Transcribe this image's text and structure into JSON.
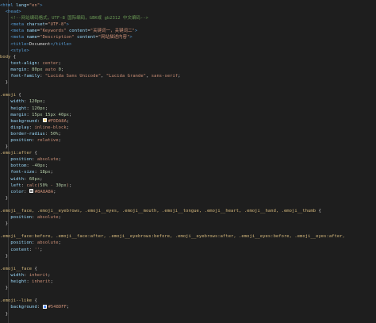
{
  "colors": {
    "background": "#1e1e1e",
    "tag": "#569cd6",
    "attribute": "#9cdcfe",
    "string": "#ce9178",
    "comment": "#6a9955",
    "selector": "#d7ba7d",
    "number": "#b5cea8",
    "swatch_emoji_bg": "#FDDA8A",
    "swatch_after": "#8A8A8A",
    "swatch_like": "#548DFF"
  },
  "lines": [
    {
      "tokens": [
        {
          "t": "tag",
          "v": "<html "
        },
        {
          "t": "attr",
          "v": "lang"
        },
        {
          "t": "punc",
          "v": "="
        },
        {
          "t": "str",
          "v": "\"en\""
        },
        {
          "t": "tag",
          "v": ">"
        }
      ]
    },
    {
      "tokens": [
        {
          "t": "text",
          "v": "  "
        },
        {
          "t": "tag",
          "v": "<head>"
        }
      ]
    },
    {
      "tokens": [
        {
          "t": "text",
          "v": "    "
        },
        {
          "t": "comment",
          "v": "<!--网站编码格式，UTF-8 国际编码，GBK或 gb2312 中文编码-->"
        }
      ]
    },
    {
      "tokens": [
        {
          "t": "text",
          "v": "    "
        },
        {
          "t": "tag",
          "v": "<meta "
        },
        {
          "t": "attr",
          "v": "charset"
        },
        {
          "t": "punc",
          "v": "="
        },
        {
          "t": "str",
          "v": "\"UTF-8\""
        },
        {
          "t": "tag",
          "v": ">"
        }
      ]
    },
    {
      "tokens": [
        {
          "t": "text",
          "v": "    "
        },
        {
          "t": "tag",
          "v": "<meta "
        },
        {
          "t": "attr",
          "v": "name"
        },
        {
          "t": "punc",
          "v": "="
        },
        {
          "t": "str",
          "v": "\"Keywords\""
        },
        {
          "t": "text",
          "v": " "
        },
        {
          "t": "attr",
          "v": "content"
        },
        {
          "t": "punc",
          "v": "="
        },
        {
          "t": "str",
          "v": "\"关键词一，关键词二\""
        },
        {
          "t": "tag",
          "v": ">"
        }
      ]
    },
    {
      "tokens": [
        {
          "t": "text",
          "v": "    "
        },
        {
          "t": "tag",
          "v": "<meta "
        },
        {
          "t": "attr",
          "v": "name"
        },
        {
          "t": "punc",
          "v": "="
        },
        {
          "t": "str",
          "v": "\"Description\""
        },
        {
          "t": "text",
          "v": " "
        },
        {
          "t": "attr",
          "v": "content"
        },
        {
          "t": "punc",
          "v": "="
        },
        {
          "t": "str",
          "v": "\"网站描述内容\""
        },
        {
          "t": "tag",
          "v": ">"
        }
      ]
    },
    {
      "tokens": [
        {
          "t": "text",
          "v": "    "
        },
        {
          "t": "tag",
          "v": "<title>"
        },
        {
          "t": "text",
          "v": "Document"
        },
        {
          "t": "tag",
          "v": "</title>"
        }
      ]
    },
    {
      "tokens": [
        {
          "t": "text",
          "v": "    "
        },
        {
          "t": "tag",
          "v": "<style>"
        }
      ]
    },
    {
      "tokens": [
        {
          "t": "sel",
          "v": "body"
        },
        {
          "t": "punc",
          "v": " {"
        }
      ]
    },
    {
      "tokens": [
        {
          "t": "text",
          "v": "    "
        },
        {
          "t": "prop",
          "v": "text-align"
        },
        {
          "t": "punc",
          "v": ": "
        },
        {
          "t": "val",
          "v": "center"
        },
        {
          "t": "punc",
          "v": ";"
        }
      ]
    },
    {
      "tokens": [
        {
          "t": "text",
          "v": "    "
        },
        {
          "t": "prop",
          "v": "margin"
        },
        {
          "t": "punc",
          "v": ": "
        },
        {
          "t": "num",
          "v": "80px"
        },
        {
          "t": "val",
          "v": " auto "
        },
        {
          "t": "num",
          "v": "0"
        },
        {
          "t": "punc",
          "v": ";"
        }
      ]
    },
    {
      "tokens": [
        {
          "t": "text",
          "v": "    "
        },
        {
          "t": "prop",
          "v": "font-family"
        },
        {
          "t": "punc",
          "v": ": "
        },
        {
          "t": "str",
          "v": "\"Lucida Sans Unicode\""
        },
        {
          "t": "punc",
          "v": ", "
        },
        {
          "t": "str",
          "v": "\"Lucida Grande\""
        },
        {
          "t": "punc",
          "v": ", "
        },
        {
          "t": "val",
          "v": "sans-serif"
        },
        {
          "t": "punc",
          "v": ";"
        }
      ]
    },
    {
      "tokens": [
        {
          "t": "punc",
          "v": "  }"
        }
      ]
    },
    {
      "tokens": []
    },
    {
      "tokens": [
        {
          "t": "sel",
          "v": ".emoji"
        },
        {
          "t": "punc",
          "v": " {"
        }
      ]
    },
    {
      "tokens": [
        {
          "t": "text",
          "v": "    "
        },
        {
          "t": "prop",
          "v": "width"
        },
        {
          "t": "punc",
          "v": ": "
        },
        {
          "t": "num",
          "v": "120px"
        },
        {
          "t": "punc",
          "v": ";"
        }
      ]
    },
    {
      "tokens": [
        {
          "t": "text",
          "v": "    "
        },
        {
          "t": "prop",
          "v": "height"
        },
        {
          "t": "punc",
          "v": ": "
        },
        {
          "t": "num",
          "v": "120px"
        },
        {
          "t": "punc",
          "v": ";"
        }
      ]
    },
    {
      "tokens": [
        {
          "t": "text",
          "v": "    "
        },
        {
          "t": "prop",
          "v": "margin"
        },
        {
          "t": "punc",
          "v": ": "
        },
        {
          "t": "num",
          "v": "15px 15px 40px"
        },
        {
          "t": "punc",
          "v": ";"
        }
      ]
    },
    {
      "tokens": [
        {
          "t": "text",
          "v": "    "
        },
        {
          "t": "prop",
          "v": "background"
        },
        {
          "t": "punc",
          "v": ": "
        },
        {
          "t": "swatch",
          "v": "#FDDA8A",
          "c": "swatch_emoji_bg"
        },
        {
          "t": "val",
          "v": "#FDDA8A"
        },
        {
          "t": "punc",
          "v": ";"
        }
      ]
    },
    {
      "tokens": [
        {
          "t": "text",
          "v": "    "
        },
        {
          "t": "prop",
          "v": "display"
        },
        {
          "t": "punc",
          "v": ": "
        },
        {
          "t": "val",
          "v": "inline-block"
        },
        {
          "t": "punc",
          "v": ";"
        }
      ]
    },
    {
      "tokens": [
        {
          "t": "text",
          "v": "    "
        },
        {
          "t": "prop",
          "v": "border-radius"
        },
        {
          "t": "punc",
          "v": ": "
        },
        {
          "t": "num",
          "v": "50%"
        },
        {
          "t": "punc",
          "v": ";"
        }
      ]
    },
    {
      "tokens": [
        {
          "t": "text",
          "v": "    "
        },
        {
          "t": "prop",
          "v": "position"
        },
        {
          "t": "punc",
          "v": ": "
        },
        {
          "t": "val",
          "v": "relative"
        },
        {
          "t": "punc",
          "v": ";"
        }
      ]
    },
    {
      "tokens": [
        {
          "t": "punc",
          "v": "  }"
        }
      ]
    },
    {
      "tokens": [
        {
          "t": "sel",
          "v": ".emoji:after"
        },
        {
          "t": "punc",
          "v": " {"
        }
      ]
    },
    {
      "tokens": [
        {
          "t": "text",
          "v": "    "
        },
        {
          "t": "prop",
          "v": "position"
        },
        {
          "t": "punc",
          "v": ": "
        },
        {
          "t": "val",
          "v": "absolute"
        },
        {
          "t": "punc",
          "v": ";"
        }
      ]
    },
    {
      "tokens": [
        {
          "t": "text",
          "v": "    "
        },
        {
          "t": "prop",
          "v": "bottom"
        },
        {
          "t": "punc",
          "v": ": "
        },
        {
          "t": "num",
          "v": "-40px"
        },
        {
          "t": "punc",
          "v": ";"
        }
      ]
    },
    {
      "tokens": [
        {
          "t": "text",
          "v": "    "
        },
        {
          "t": "prop",
          "v": "font-size"
        },
        {
          "t": "punc",
          "v": ": "
        },
        {
          "t": "num",
          "v": "18px"
        },
        {
          "t": "punc",
          "v": ";"
        }
      ]
    },
    {
      "tokens": [
        {
          "t": "text",
          "v": "    "
        },
        {
          "t": "prop",
          "v": "width"
        },
        {
          "t": "punc",
          "v": ": "
        },
        {
          "t": "num",
          "v": "60px"
        },
        {
          "t": "punc",
          "v": ";"
        }
      ]
    },
    {
      "tokens": [
        {
          "t": "text",
          "v": "    "
        },
        {
          "t": "prop",
          "v": "left"
        },
        {
          "t": "punc",
          "v": ": "
        },
        {
          "t": "val",
          "v": "calc("
        },
        {
          "t": "num",
          "v": "50%"
        },
        {
          "t": "val",
          "v": " - "
        },
        {
          "t": "num",
          "v": "30px"
        },
        {
          "t": "val",
          "v": ")"
        },
        {
          "t": "punc",
          "v": ";"
        }
      ]
    },
    {
      "tokens": [
        {
          "t": "text",
          "v": "    "
        },
        {
          "t": "prop",
          "v": "color"
        },
        {
          "t": "punc",
          "v": ": "
        },
        {
          "t": "swatch",
          "v": "#8A8A8A",
          "c": "swatch_after"
        },
        {
          "t": "val",
          "v": "#8A8A8A"
        },
        {
          "t": "punc",
          "v": ";"
        }
      ]
    },
    {
      "tokens": [
        {
          "t": "punc",
          "v": "  }"
        }
      ]
    },
    {
      "tokens": []
    },
    {
      "tokens": [
        {
          "t": "sel",
          "v": ".emoji__face, .emoji__eyebrows, .emoji__eyes, .emoji__mouth, .emoji__tongue, .emoji__heart, .emoji__hand, .emoji__thumb"
        },
        {
          "t": "punc",
          "v": " {"
        }
      ]
    },
    {
      "tokens": [
        {
          "t": "text",
          "v": "    "
        },
        {
          "t": "prop",
          "v": "position"
        },
        {
          "t": "punc",
          "v": ": "
        },
        {
          "t": "val",
          "v": "absolute"
        },
        {
          "t": "punc",
          "v": ";"
        }
      ]
    },
    {
      "tokens": [
        {
          "t": "punc",
          "v": "  }"
        }
      ]
    },
    {
      "tokens": []
    },
    {
      "tokens": [
        {
          "t": "sel",
          "v": ".emoji__face:before, .emoji__face:after, .emoji__eyebrows:before, .emoji__eyebrows:after, .emoji__eyes:before, .emoji__eyes:after,"
        }
      ]
    },
    {
      "tokens": [
        {
          "t": "text",
          "v": "    "
        },
        {
          "t": "prop",
          "v": "position"
        },
        {
          "t": "punc",
          "v": ": "
        },
        {
          "t": "val",
          "v": "absolute"
        },
        {
          "t": "punc",
          "v": ";"
        }
      ]
    },
    {
      "tokens": [
        {
          "t": "text",
          "v": "    "
        },
        {
          "t": "prop",
          "v": "content"
        },
        {
          "t": "punc",
          "v": ": "
        },
        {
          "t": "str",
          "v": "''"
        },
        {
          "t": "punc",
          "v": ";"
        }
      ]
    },
    {
      "tokens": [
        {
          "t": "punc",
          "v": "  }"
        }
      ]
    },
    {
      "tokens": []
    },
    {
      "tokens": [
        {
          "t": "sel",
          "v": ".emoji__face"
        },
        {
          "t": "punc",
          "v": " {"
        }
      ]
    },
    {
      "tokens": [
        {
          "t": "text",
          "v": "    "
        },
        {
          "t": "prop",
          "v": "width"
        },
        {
          "t": "punc",
          "v": ": "
        },
        {
          "t": "val",
          "v": "inherit"
        },
        {
          "t": "punc",
          "v": ";"
        }
      ]
    },
    {
      "tokens": [
        {
          "t": "text",
          "v": "    "
        },
        {
          "t": "prop",
          "v": "height"
        },
        {
          "t": "punc",
          "v": ": "
        },
        {
          "t": "val",
          "v": "inherit"
        },
        {
          "t": "punc",
          "v": ";"
        }
      ]
    },
    {
      "tokens": [
        {
          "t": "punc",
          "v": "  }"
        }
      ]
    },
    {
      "tokens": []
    },
    {
      "tokens": [
        {
          "t": "sel",
          "v": ".emoji--like"
        },
        {
          "t": "punc",
          "v": " {"
        }
      ]
    },
    {
      "tokens": [
        {
          "t": "text",
          "v": "    "
        },
        {
          "t": "prop",
          "v": "background"
        },
        {
          "t": "punc",
          "v": ": "
        },
        {
          "t": "swatch",
          "v": "#548DFF",
          "c": "swatch_like"
        },
        {
          "t": "val",
          "v": "#548DFF"
        },
        {
          "t": "punc",
          "v": ";"
        }
      ]
    },
    {
      "tokens": [
        {
          "t": "punc",
          "v": "  }"
        }
      ]
    }
  ]
}
